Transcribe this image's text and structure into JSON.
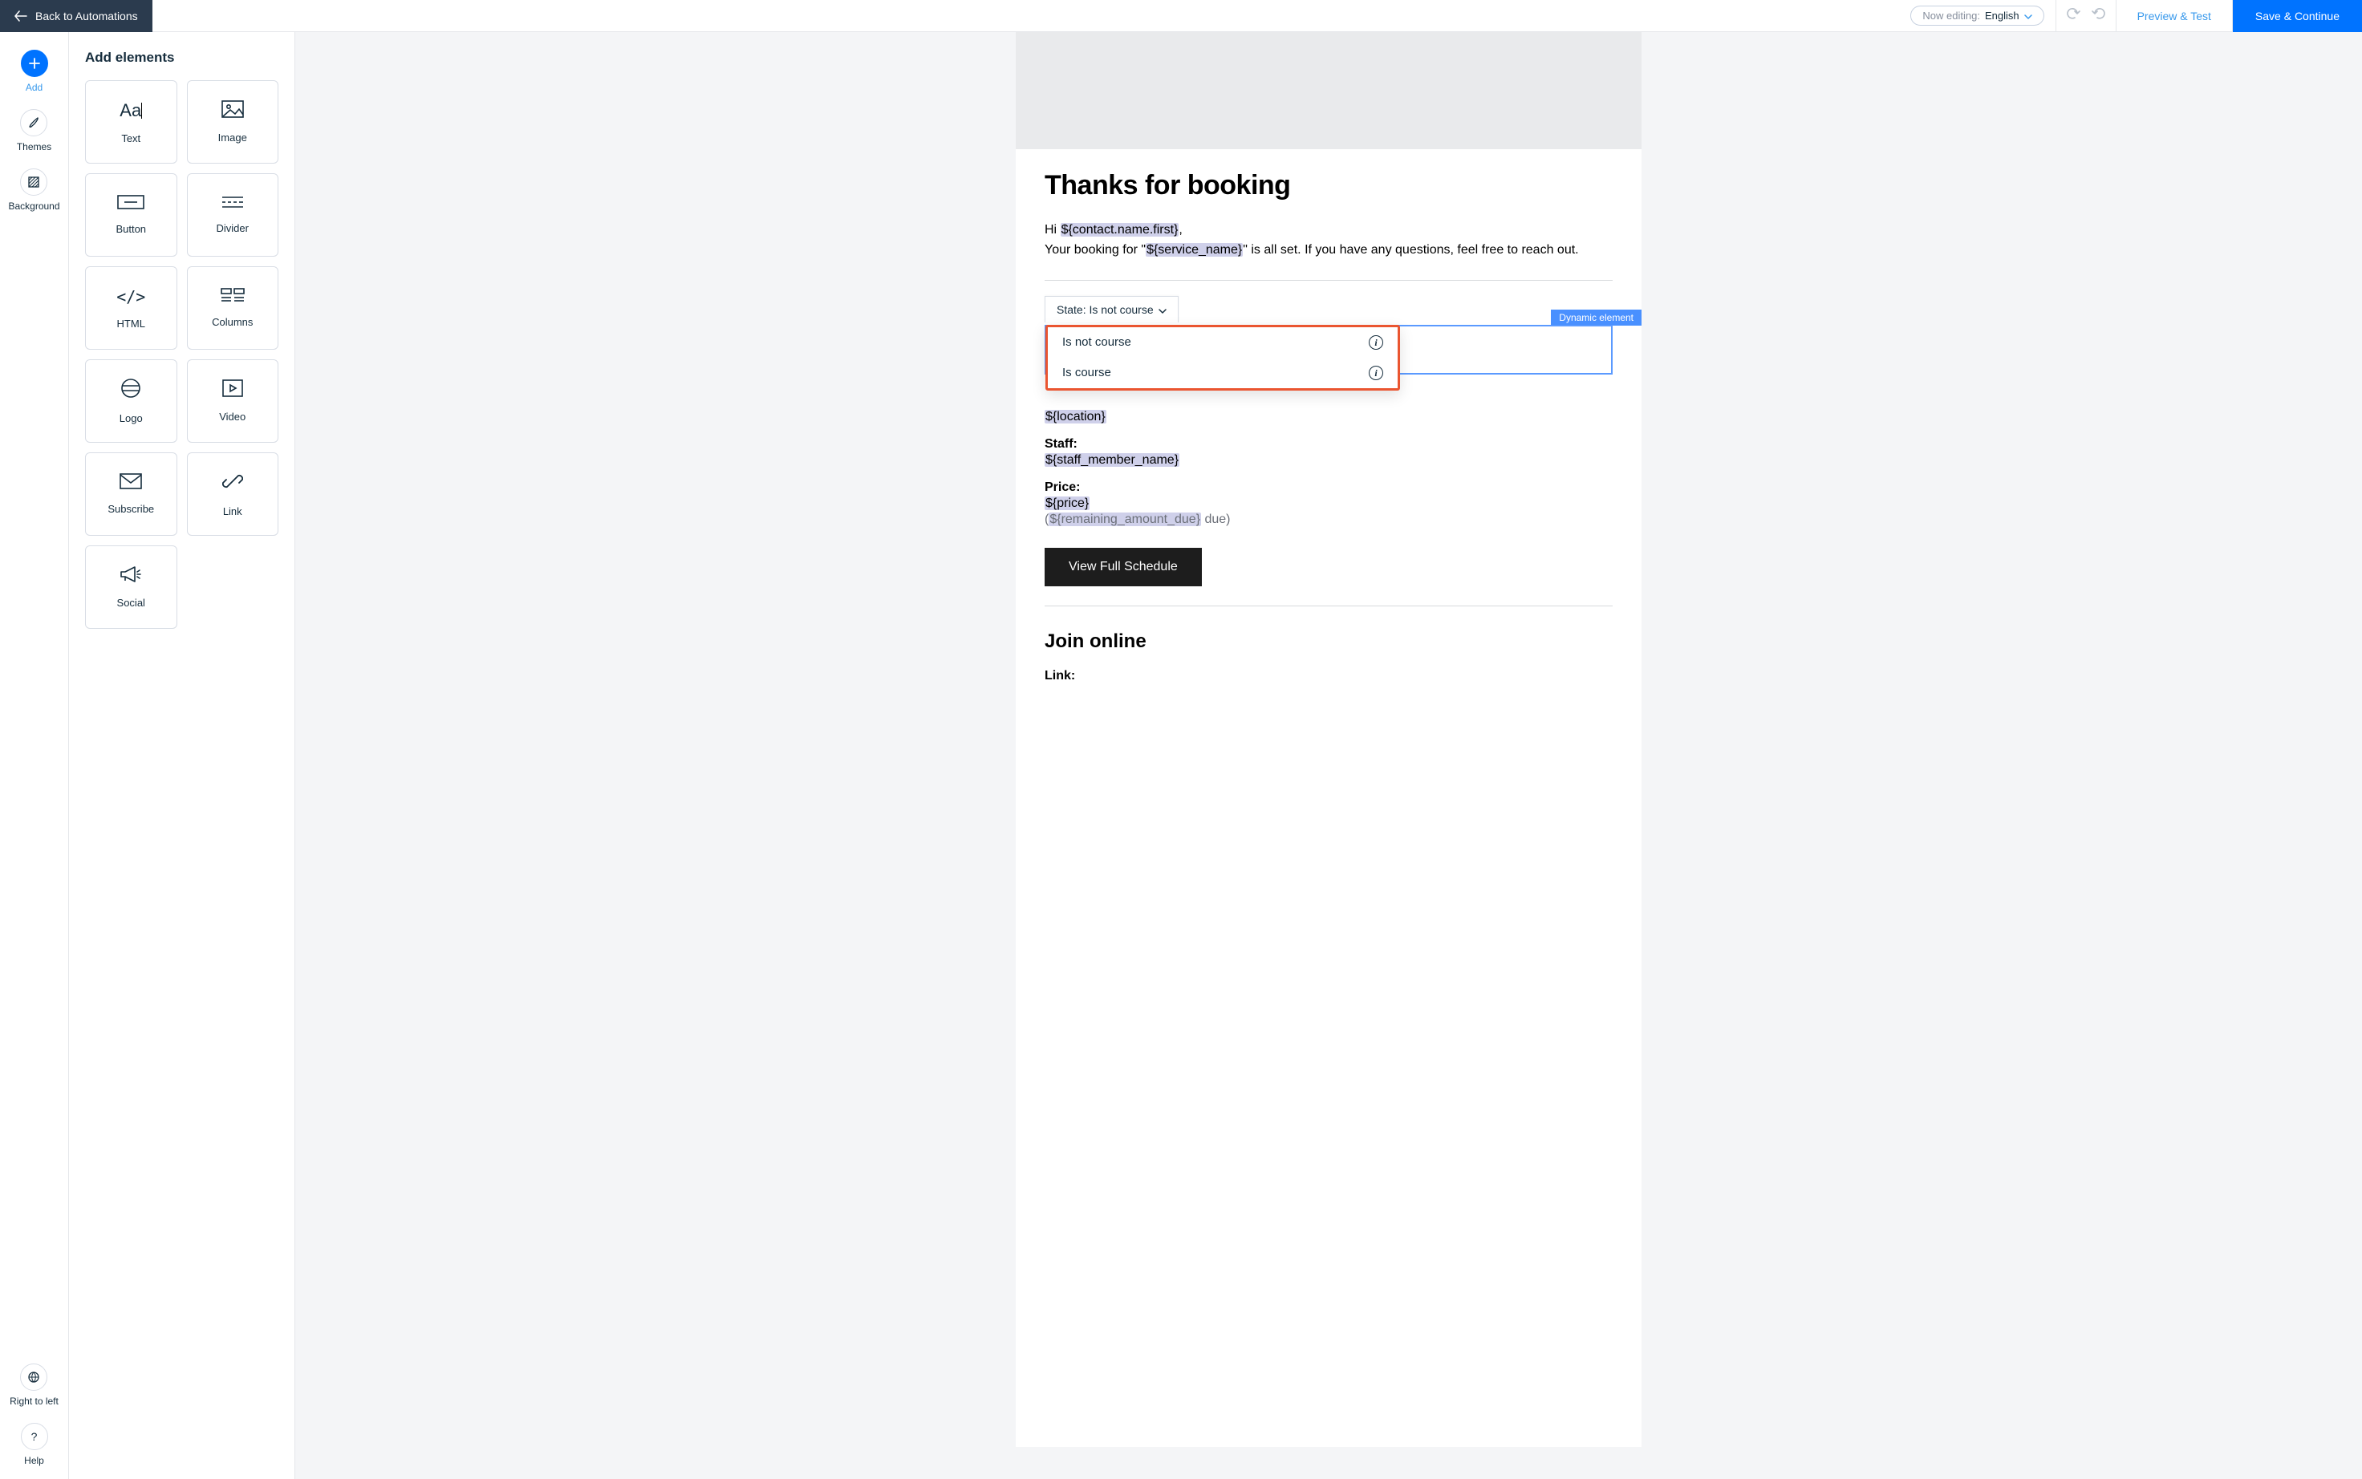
{
  "topbar": {
    "back_label": "Back to Automations",
    "now_editing_label": "Now editing:",
    "language": "English",
    "preview_label": "Preview & Test",
    "save_label": "Save & Continue"
  },
  "rail": {
    "add": "Add",
    "themes": "Themes",
    "background": "Background",
    "rtl": "Right to left",
    "help": "Help"
  },
  "panel": {
    "title": "Add elements",
    "items": [
      {
        "id": "text",
        "label": "Text"
      },
      {
        "id": "image",
        "label": "Image"
      },
      {
        "id": "button",
        "label": "Button"
      },
      {
        "id": "divider",
        "label": "Divider"
      },
      {
        "id": "html",
        "label": "HTML"
      },
      {
        "id": "columns",
        "label": "Columns"
      },
      {
        "id": "logo",
        "label": "Logo"
      },
      {
        "id": "video",
        "label": "Video"
      },
      {
        "id": "subscribe",
        "label": "Subscribe"
      },
      {
        "id": "link",
        "label": "Link"
      },
      {
        "id": "social",
        "label": "Social"
      }
    ]
  },
  "email": {
    "heading": "Thanks for booking",
    "greeting_prefix": "Hi ",
    "greeting_token": "${contact.name.first}",
    "greeting_suffix": ",",
    "line2_a": "Your booking for \"",
    "line2_token": "${service_name}",
    "line2_b": "\" is all set. If you have any questions, feel free to reach out.",
    "service_token_partial": "ame}",
    "loc_label": "${location}",
    "staff_label": "Staff:",
    "staff_value": "${staff_member_name}",
    "price_label": "Price:",
    "price_value": "${price}",
    "due_prefix": "(",
    "due_token": "${remaining_amount_due}",
    "due_suffix": " due)",
    "cta": "View Full Schedule",
    "join_heading": "Join online",
    "link_label": "Link:"
  },
  "dynamic": {
    "tag": "Dynamic element",
    "state_label": "State: Is not course",
    "options": [
      "Is not course",
      "Is course"
    ]
  }
}
